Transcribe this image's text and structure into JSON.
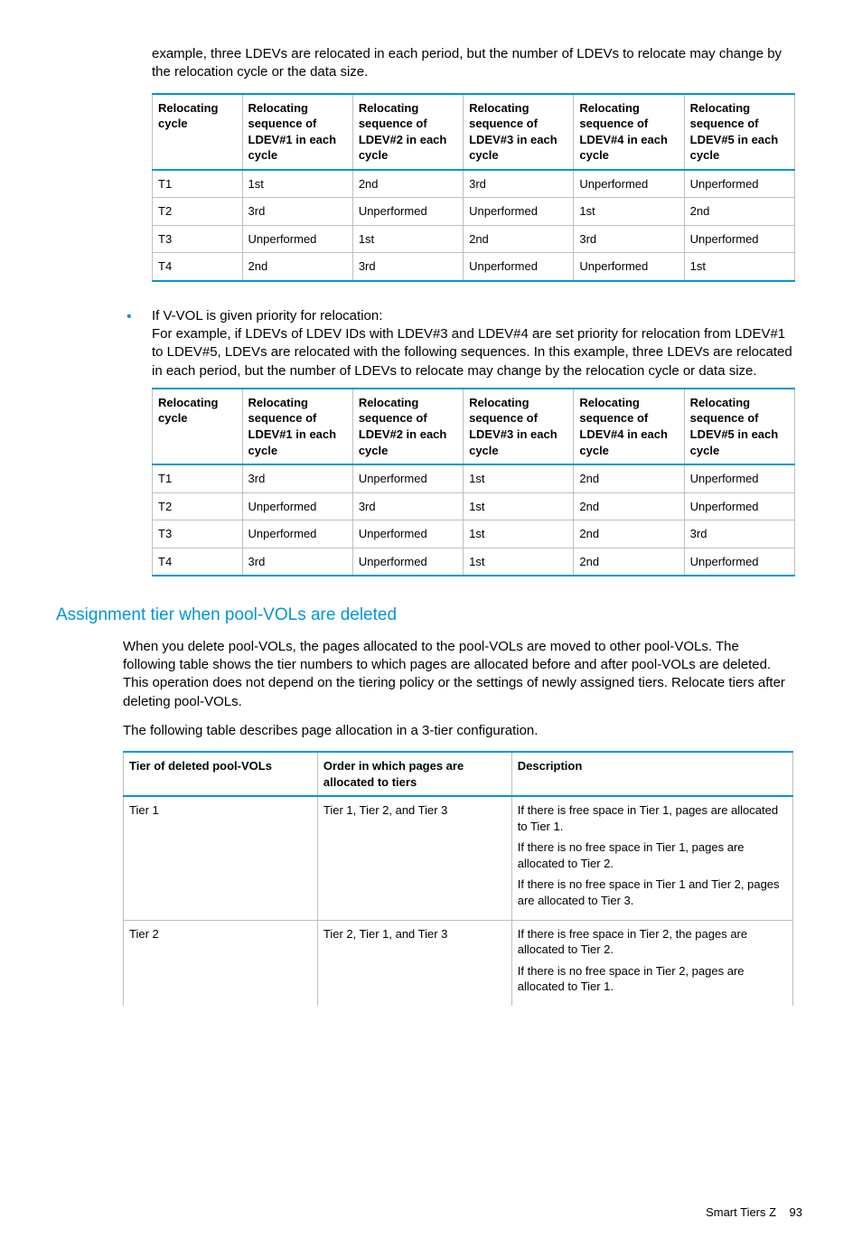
{
  "intro_para": "example, three LDEVs are relocated in each period, but the number of LDEVs to relocate may change by the relocation cycle or the data size.",
  "table1": {
    "headers": [
      "Relocating cycle",
      "Relocating sequence of LDEV#1 in each cycle",
      "Relocating sequence of LDEV#2 in each cycle",
      "Relocating sequence of LDEV#3 in each cycle",
      "Relocating sequence of LDEV#4 in each cycle",
      "Relocating sequence of LDEV#5 in each cycle"
    ],
    "rows": [
      [
        "T1",
        "1st",
        "2nd",
        "3rd",
        "Unperformed",
        "Unperformed"
      ],
      [
        "T2",
        "3rd",
        "Unperformed",
        "Unperformed",
        "1st",
        "2nd"
      ],
      [
        "T3",
        "Unperformed",
        "1st",
        "2nd",
        "3rd",
        "Unperformed"
      ],
      [
        "T4",
        "2nd",
        "3rd",
        "Unperformed",
        "Unperformed",
        "1st"
      ]
    ]
  },
  "bullet_title": "If V-VOL is given priority for relocation:",
  "bullet_body": "For example, if LDEVs of LDEV IDs with LDEV#3 and LDEV#4 are set priority for relocation from LDEV#1 to LDEV#5, LDEVs are relocated with the following sequences. In this example, three LDEVs are relocated in each period, but the number of LDEVs to relocate may change by the relocation cycle or data size.",
  "table2": {
    "headers": [
      "Relocating cycle",
      "Relocating sequence of LDEV#1 in each cycle",
      "Relocating sequence of LDEV#2 in each cycle",
      "Relocating sequence of LDEV#3 in each cycle",
      "Relocating sequence of LDEV#4 in each cycle",
      "Relocating sequence of LDEV#5 in each cycle"
    ],
    "rows": [
      [
        "T1",
        "3rd",
        "Unperformed",
        "1st",
        "2nd",
        "Unperformed"
      ],
      [
        "T2",
        "Unperformed",
        "3rd",
        "1st",
        "2nd",
        "Unperformed"
      ],
      [
        "T3",
        "Unperformed",
        "Unperformed",
        "1st",
        "2nd",
        "3rd"
      ],
      [
        "T4",
        "3rd",
        "Unperformed",
        "1st",
        "2nd",
        "Unperformed"
      ]
    ]
  },
  "section_heading": "Assignment tier when pool-VOLs are deleted",
  "section_p1": "When you delete pool-VOLs, the pages allocated to the pool-VOLs are moved to other pool-VOLs. The following table shows the tier numbers to which pages are allocated before and after pool-VOLs are deleted. This operation does not depend on the tiering policy or the settings of newly assigned tiers. Relocate tiers after deleting pool-VOLs.",
  "section_p2": "The following table describes page allocation in a 3-tier configuration.",
  "table3": {
    "headers": [
      "Tier of deleted pool-VOLs",
      "Order in which pages are allocated to tiers",
      "Description"
    ],
    "rows": [
      {
        "c0": "Tier 1",
        "c1": "Tier 1, Tier 2, and Tier 3",
        "c2": [
          "If there is free space in Tier 1, pages are allocated to Tier 1.",
          "If there is no free space in Tier 1, pages are allocated to Tier 2.",
          "If there is no free space in Tier 1 and Tier 2, pages are allocated to Tier 3."
        ]
      },
      {
        "c0": "Tier 2",
        "c1": "Tier 2, Tier 1, and Tier 3",
        "c2": [
          "If there is free space in Tier 2, the pages are allocated to Tier 2.",
          "If there is no free space in Tier 2, pages are allocated to Tier 1."
        ]
      }
    ]
  },
  "footer_label": "Smart Tiers Z",
  "footer_page": "93"
}
